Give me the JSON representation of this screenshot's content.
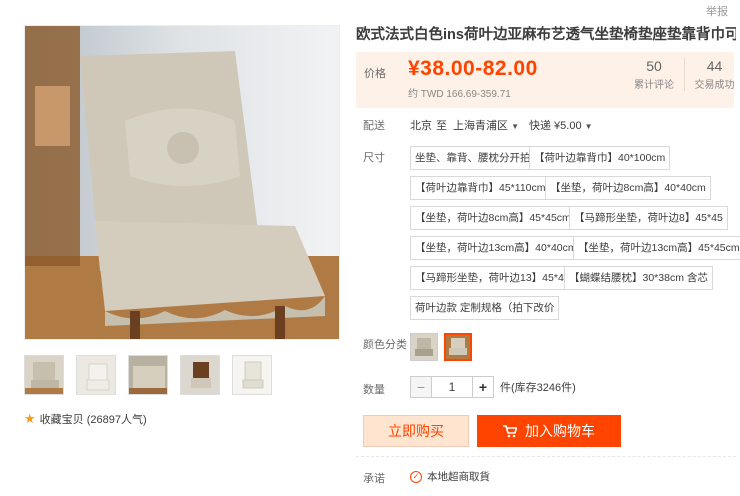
{
  "report": "举报",
  "product": {
    "title": "欧式法式白色ins荷叶边亚麻布艺透气坐垫椅垫座垫靠背巾可拆洗"
  },
  "price": {
    "label": "价格",
    "value": "¥38.00-82.00",
    "twd": "约 TWD 166.69-359.71"
  },
  "stats": [
    {
      "num": "50",
      "label": "累计评论"
    },
    {
      "num": "44",
      "label": "交易成功"
    }
  ],
  "delivery": {
    "label": "配送",
    "from": "北京",
    "to_word": "至",
    "dest": "上海青浦区",
    "express": "快递 ¥5.00"
  },
  "size": {
    "label": "尺寸",
    "options": [
      "坐垫、靠背、腰枕分开拍",
      "【荷叶边靠背巾】40*100cm",
      "【荷叶边靠背巾】45*110cm",
      "【坐垫，荷叶边8cm高】40*40cm",
      "【坐垫，荷叶边8cm高】45*45cm",
      "【马蹄形坐垫，荷叶边8】45*45",
      "【坐垫，荷叶边13cm高】40*40cm",
      "【坐垫，荷叶边13cm高】45*45cm",
      "【马蹄形坐垫，荷叶边13】45*45",
      "【蝴蝶结腰枕】30*38cm 含芯",
      "荷叶边款 定制规格（拍下改价"
    ]
  },
  "color": {
    "label": "颜色分类"
  },
  "quantity": {
    "label": "数量",
    "minus": "−",
    "value": "1",
    "plus": "+",
    "stock": "件(库存3246件)"
  },
  "buttons": {
    "buy": "立即购买",
    "cart": "加入购物车"
  },
  "promise": {
    "label": "承诺",
    "text": "本地超商取貨"
  },
  "favorite": {
    "text": "收藏宝贝 (26897人气)"
  },
  "colors": {
    "accent": "#ff4400",
    "price_bg": "#fdf1e8"
  }
}
